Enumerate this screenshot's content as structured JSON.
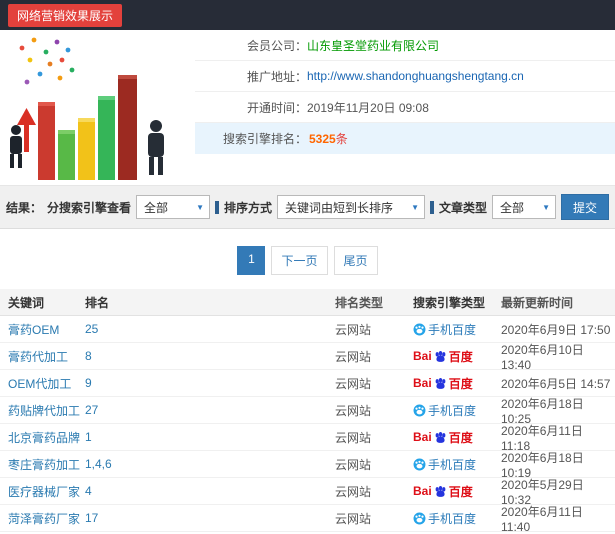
{
  "topbar": {
    "title": "网络营销效果展示"
  },
  "profile": {
    "company_label": "会员公司：",
    "company_value": "山东皇圣堂药业有限公司",
    "url_label": "推广地址：",
    "url_value": "http://www.shandonghuangshengtang.cn",
    "opened_label": "开通时间：",
    "opened_value": "2019年11月20日 09:08",
    "rank_label": "搜索引擎排名：",
    "rank_count": "5325",
    "rank_unit": "条"
  },
  "filters": {
    "result_label": "结果：",
    "engine_label": "分搜索引擎查看",
    "engine_value": "全部",
    "sort_label": "排序方式",
    "sort_value": "关键词由短到长排序",
    "article_label": "文章类型",
    "article_value": "全部",
    "submit_label": "提交"
  },
  "pagination": {
    "current": "1",
    "next_label": "下一页",
    "last_label": "尾页"
  },
  "logos": {
    "baidu_prefix": "Bai",
    "baidu_text": "百度",
    "mobile_text": "手机百度"
  },
  "table": {
    "headers": [
      "关键词",
      "排名",
      "排名类型",
      "搜索引擎类型",
      "最新更新时间"
    ],
    "rows": [
      {
        "keyword": "膏药OEM",
        "rank": "25",
        "rank_type": "云网站",
        "engine": "mobile-baidu",
        "updated": "2020年6月9日 17:50"
      },
      {
        "keyword": "膏药代加工",
        "rank": "8",
        "rank_type": "云网站",
        "engine": "baidu",
        "updated": "2020年6月10日 13:40"
      },
      {
        "keyword": "OEM代加工",
        "rank": "9",
        "rank_type": "云网站",
        "engine": "baidu",
        "updated": "2020年6月5日 14:57"
      },
      {
        "keyword": "药贴牌代加工",
        "rank": "27",
        "rank_type": "云网站",
        "engine": "mobile-baidu",
        "updated": "2020年6月18日 10:25"
      },
      {
        "keyword": "北京膏药品牌",
        "rank": "1",
        "rank_type": "云网站",
        "engine": "baidu",
        "updated": "2020年6月11日 11:18"
      },
      {
        "keyword": "枣庄膏药加工",
        "rank": "1,4,6",
        "rank_type": "云网站",
        "engine": "mobile-baidu",
        "updated": "2020年6月18日 10:19"
      },
      {
        "keyword": "医疗器械厂家",
        "rank": "4",
        "rank_type": "云网站",
        "engine": "baidu",
        "updated": "2020年5月29日 10:32"
      },
      {
        "keyword": "菏泽膏药厂家",
        "rank": "17",
        "rank_type": "云网站",
        "engine": "mobile-baidu",
        "updated": "2020年6月11日 11:40"
      }
    ]
  }
}
